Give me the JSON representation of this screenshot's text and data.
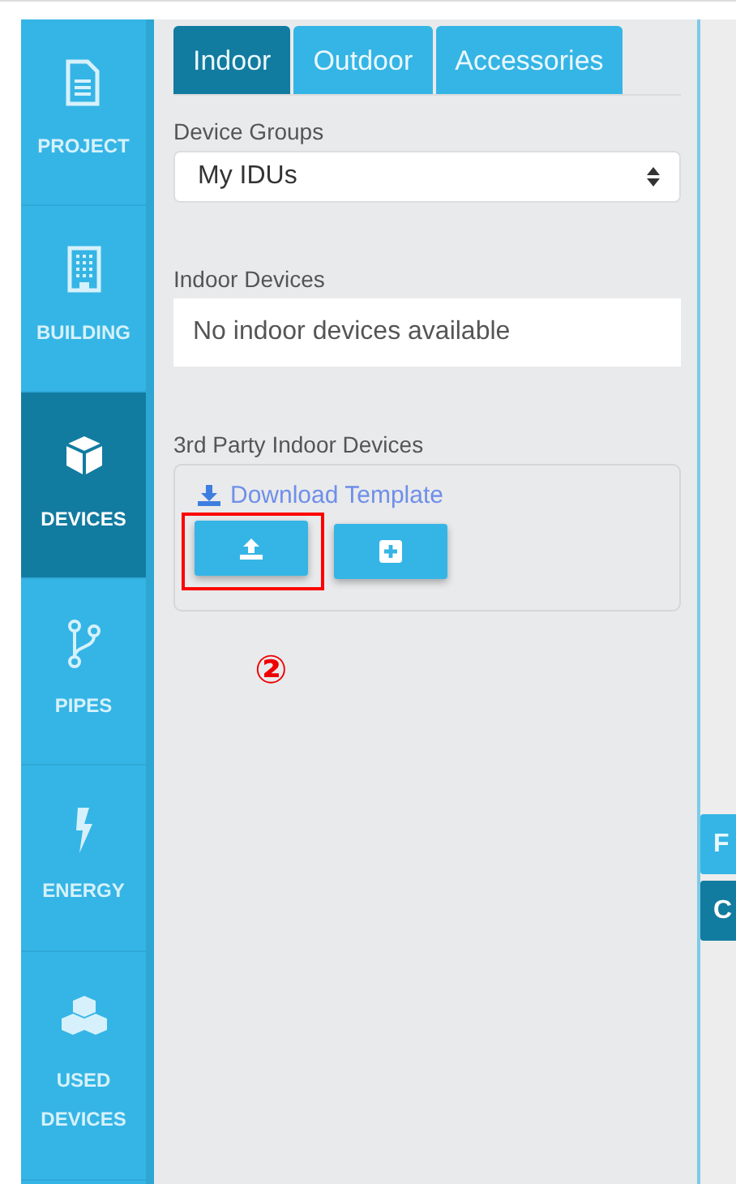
{
  "sidebar": {
    "items": [
      {
        "label": "PROJECT",
        "kind": "document",
        "selected": false
      },
      {
        "label": "BUILDING",
        "kind": "building",
        "selected": false
      },
      {
        "label": "DEVICES",
        "kind": "cube",
        "selected": true
      },
      {
        "label": "PIPES",
        "kind": "branch",
        "selected": false
      },
      {
        "label": "ENERGY",
        "kind": "bolt",
        "selected": false
      },
      {
        "label": "USED DEVICES",
        "kind": "cubes",
        "selected": false
      }
    ]
  },
  "tabs": [
    {
      "label": "Indoor",
      "selected": true
    },
    {
      "label": "Outdoor",
      "selected": false
    },
    {
      "label": "Accessories",
      "selected": false
    }
  ],
  "device_groups": {
    "label": "Device Groups",
    "value": "My IDUs"
  },
  "indoor_devices": {
    "label": "Indoor Devices",
    "empty_text": "No indoor devices available"
  },
  "third_party": {
    "label": "3rd Party Indoor Devices",
    "download_link": "Download Template",
    "buttons": [
      {
        "kind": "upload",
        "highlighted": true
      },
      {
        "kind": "add",
        "highlighted": false
      }
    ]
  },
  "annotation": "②",
  "right_tabs": [
    {
      "label": "F",
      "selected": false
    },
    {
      "label": "C",
      "selected": true
    }
  ]
}
